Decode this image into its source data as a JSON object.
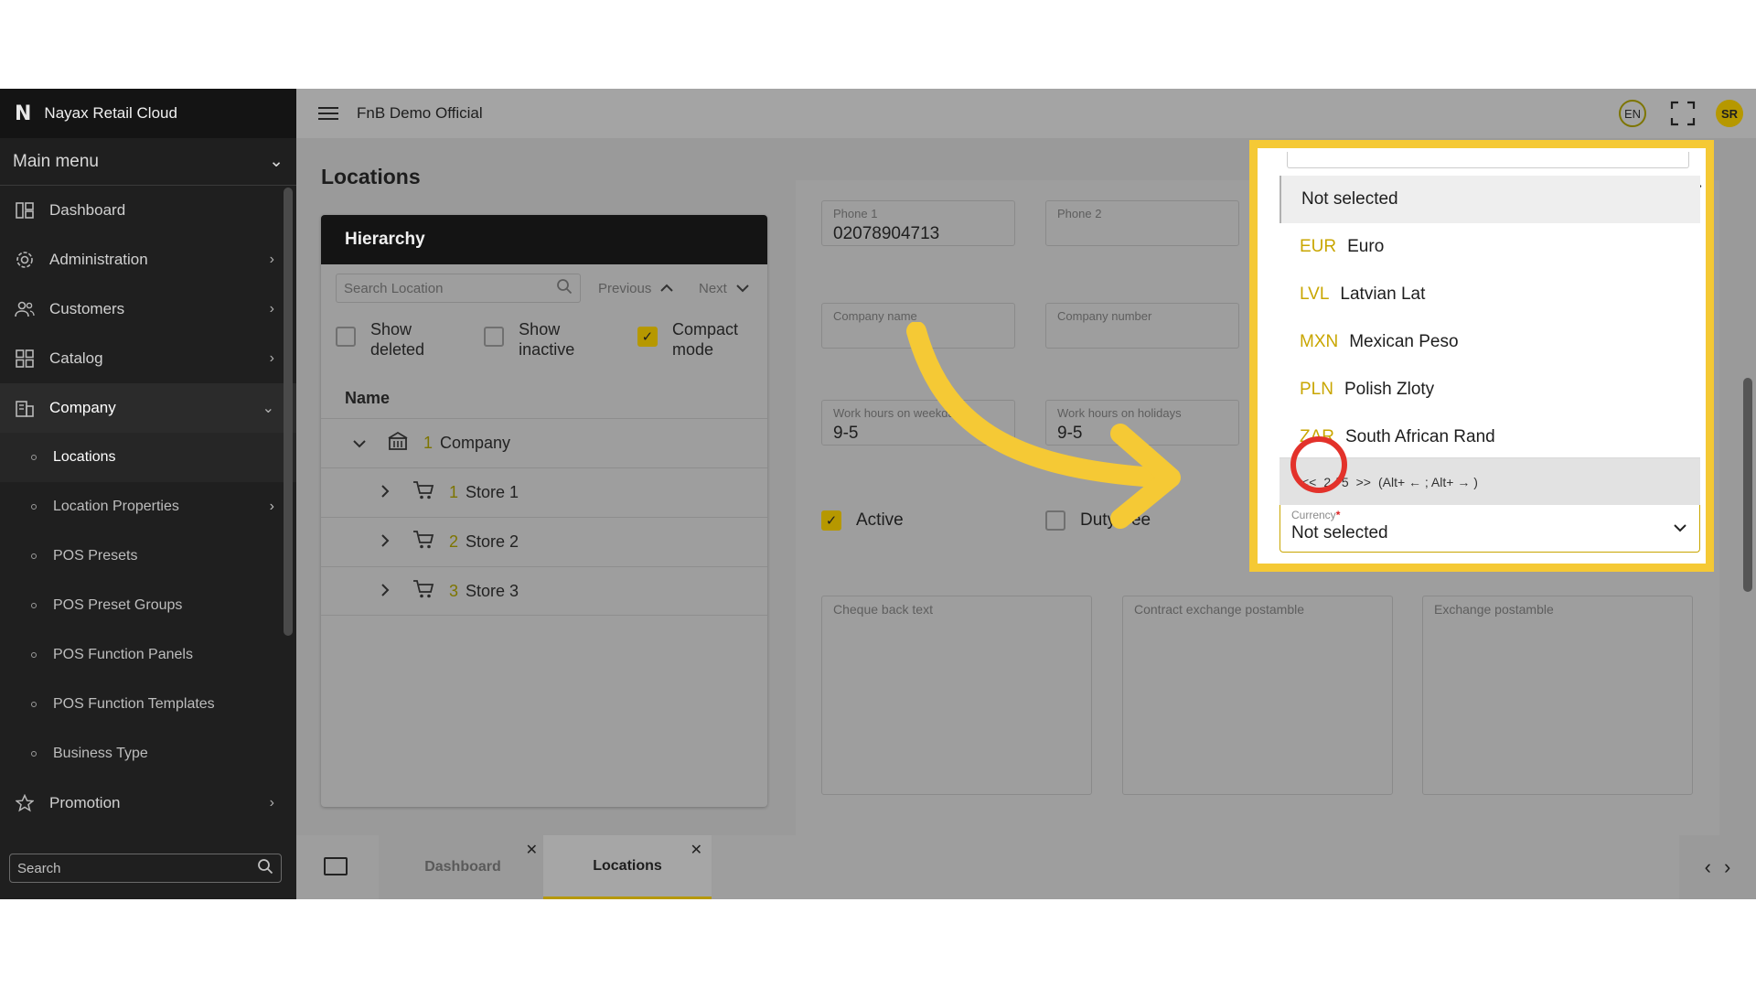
{
  "app": {
    "logo": "N",
    "name": "Nayax Retail Cloud",
    "org": "FnB Demo Official"
  },
  "sidebar": {
    "menu_title": "Main menu",
    "items": [
      {
        "label": "Dashboard",
        "icon": "dashboard-icon"
      },
      {
        "label": "Administration",
        "icon": "settings-icon"
      },
      {
        "label": "Customers",
        "icon": "users-icon"
      },
      {
        "label": "Catalog",
        "icon": "grid-icon"
      },
      {
        "label": "Company",
        "icon": "building-icon"
      }
    ],
    "sub_items": [
      "Locations",
      "Location Properties",
      "POS Presets",
      "POS Preset Groups",
      "POS Function Panels",
      "POS Function Templates",
      "Business Type"
    ],
    "promotion": "Promotion",
    "search_placeholder": "Search"
  },
  "topbar": {
    "lang": "EN",
    "avatar": "SR"
  },
  "page": {
    "title": "Locations"
  },
  "hierarchy": {
    "title": "Hierarchy",
    "search_placeholder": "Search Location",
    "prev": "Previous",
    "next": "Next",
    "show_deleted": [
      "Show",
      "deleted"
    ],
    "show_inactive": [
      "Show",
      "inactive"
    ],
    "compact_mode": [
      "Compact",
      "mode"
    ],
    "column": "Name",
    "rows": [
      {
        "num": "1",
        "name": "Company"
      },
      {
        "num": "1",
        "name": "Store 1"
      },
      {
        "num": "2",
        "name": "Store 2"
      },
      {
        "num": "3",
        "name": "Store 3"
      }
    ]
  },
  "form": {
    "phone1": {
      "label": "Phone 1",
      "value": "02078904713"
    },
    "phone2": {
      "label": "Phone 2",
      "value": ""
    },
    "company_name": {
      "label": "Company name",
      "value": ""
    },
    "company_number": {
      "label": "Company number",
      "value": ""
    },
    "work_hours_weekdays": {
      "label": "Work hours on weekdays",
      "value": "9-5"
    },
    "work_hours_holidays": {
      "label": "Work hours on holidays",
      "value": "9-5"
    },
    "active": "Active",
    "duty_free": "Duty free",
    "cheque_back": "Cheque back text",
    "contract_exchange": "Contract exchange postamble",
    "exchange": "Exchange postamble"
  },
  "currency_dropdown": {
    "options": [
      {
        "code": "",
        "label": "Not selected"
      },
      {
        "code": "EUR",
        "label": "Euro"
      },
      {
        "code": "LVL",
        "label": "Latvian Lat"
      },
      {
        "code": "MXN",
        "label": "Mexican Peso"
      },
      {
        "code": "PLN",
        "label": "Polish Zloty"
      },
      {
        "code": "ZAR",
        "label": "South African Rand"
      }
    ],
    "pager_first": "<<",
    "pager_page": "2 / 5",
    "pager_next": ">>",
    "pager_hint": "(Alt+ ← ; Alt+ → )",
    "field_label": "Currency",
    "field_value": "Not selected"
  },
  "tabs": [
    "Dashboard",
    "Locations"
  ],
  "colors": {
    "accent": "#b69800",
    "highlight": "#f5c935",
    "ring": "#e3322b"
  }
}
